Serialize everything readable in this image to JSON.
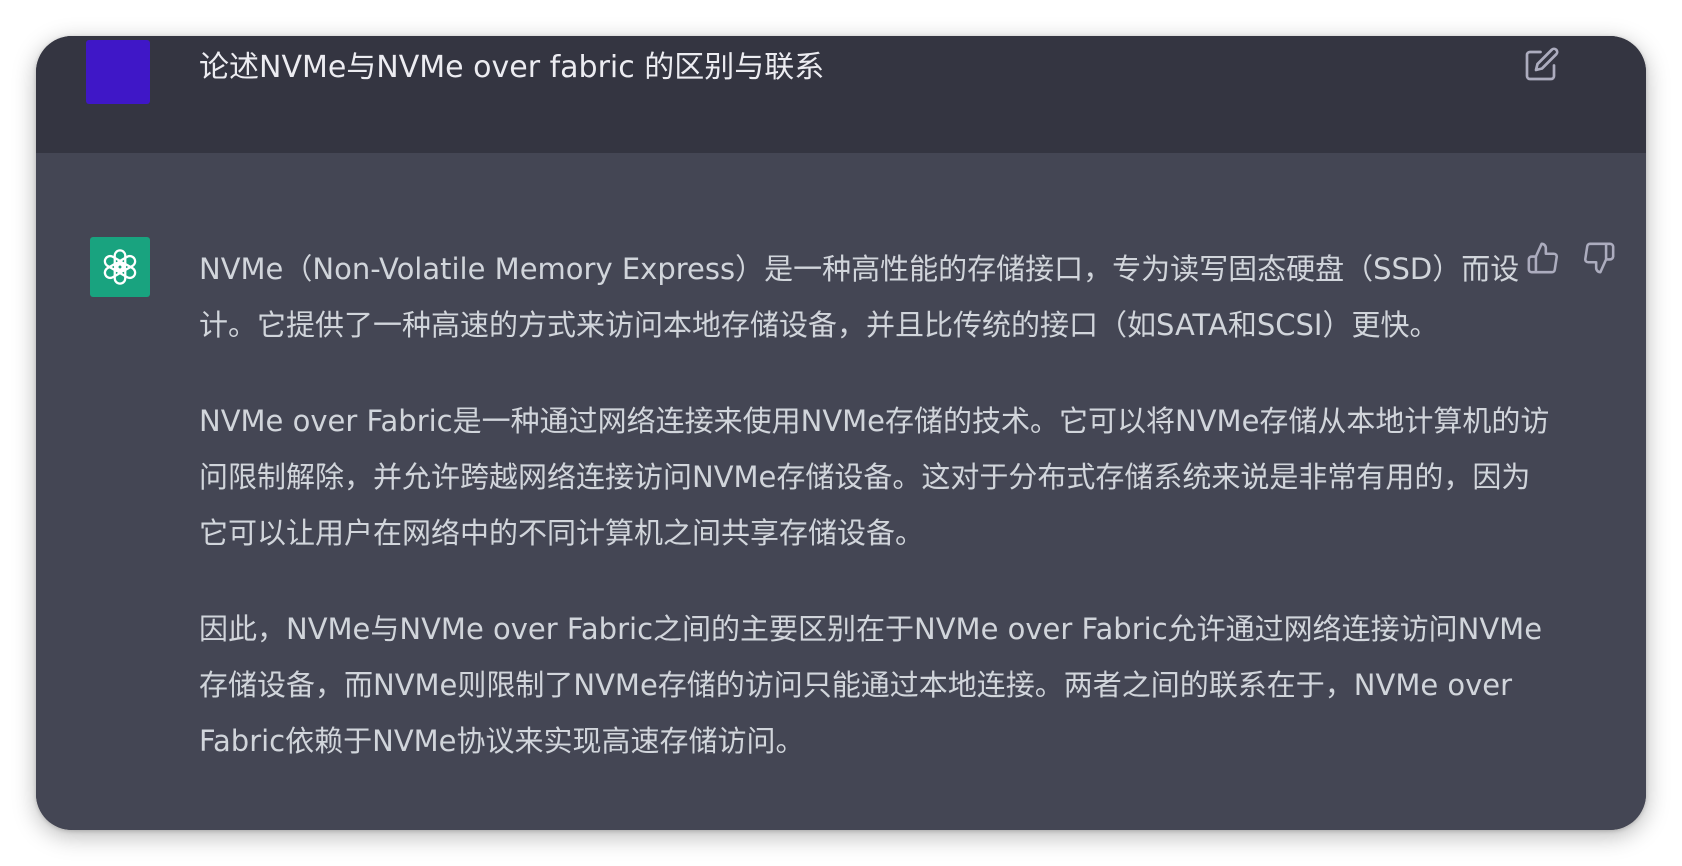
{
  "conversation": {
    "user_message": "论述NVMe与NVMe over fabric 的区别与联系",
    "assistant_paragraphs": [
      "NVMe（Non-Volatile Memory Express）是一种高性能的存储接口，专为读写固态硬盘（SSD）而设计。它提供了一种高速的方式来访问本地存储设备，并且比传统的接口（如SATA和SCSI）更快。",
      "NVMe over Fabric是一种通过网络连接来使用NVMe存储的技术。它可以将NVMe存储从本地计算机的访问限制解除，并允许跨越网络连接访问NVMe存储设备。这对于分布式存储系统来说是非常有用的，因为它可以让用户在网络中的不同计算机之间共享存储设备。",
      "因此，NVMe与NVMe over Fabric之间的主要区别在于NVMe over Fabric允许通过网络连接访问NVMe存储设备，而NVMe则限制了NVMe存储的访问只能通过本地连接。两者之间的联系在于，NVMe over Fabric依赖于NVMe协议来实现高速存储访问。"
    ]
  },
  "icons": {
    "edit": "edit-icon",
    "assistant_logo": "openai-logo-icon",
    "thumbs_up": "thumbs-up-icon",
    "thumbs_down": "thumbs-down-icon"
  },
  "colors": {
    "user_row_bg": "#343541",
    "assistant_row_bg": "#444654",
    "user_avatar": "#3f17c7",
    "assistant_avatar": "#19a37f",
    "user_text": "#ececf1",
    "assistant_text": "#d1d5db",
    "icon": "#acacbe"
  }
}
